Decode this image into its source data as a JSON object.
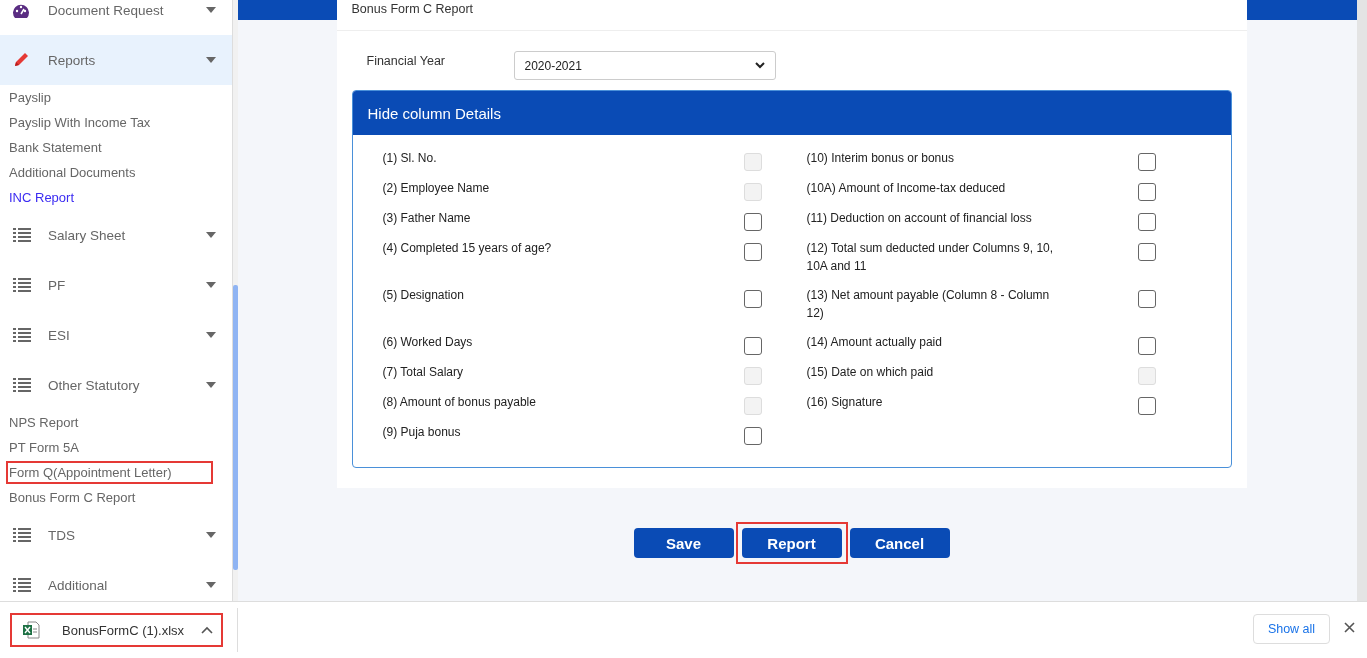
{
  "sidebar": {
    "entries": [
      {
        "kind": "group",
        "label": "Document Request",
        "selected": false
      },
      {
        "kind": "group",
        "label": "Reports",
        "selected": true
      },
      {
        "kind": "link",
        "label": "Payslip",
        "selected": false,
        "highlighted": false
      },
      {
        "kind": "link",
        "label": "Payslip With Income Tax",
        "selected": false,
        "highlighted": false
      },
      {
        "kind": "link",
        "label": "Bank Statement",
        "selected": false,
        "highlighted": false
      },
      {
        "kind": "link",
        "label": "Additional Documents",
        "selected": false,
        "highlighted": false
      },
      {
        "kind": "link",
        "label": "INC Report",
        "selected": true,
        "highlighted": false
      },
      {
        "kind": "group",
        "label": "Salary Sheet",
        "selected": false
      },
      {
        "kind": "group",
        "label": "PF",
        "selected": false
      },
      {
        "kind": "group",
        "label": "ESI",
        "selected": false
      },
      {
        "kind": "group",
        "label": "Other Statutory",
        "selected": false
      },
      {
        "kind": "link",
        "label": "NPS Report",
        "selected": false,
        "highlighted": false
      },
      {
        "kind": "link",
        "label": "PT Form 5A",
        "selected": false,
        "highlighted": false
      },
      {
        "kind": "link",
        "label": "Form Q(Appointment Letter)",
        "selected": false,
        "highlighted": true
      },
      {
        "kind": "link",
        "label": "Bonus Form C Report",
        "selected": false,
        "highlighted": false
      },
      {
        "kind": "group",
        "label": "TDS",
        "selected": false
      },
      {
        "kind": "group",
        "label": "Additional",
        "selected": false
      }
    ]
  },
  "card": {
    "title": "Bonus Form C Report",
    "financial_year": {
      "label": "Financial Year",
      "value": "2020-2021"
    },
    "panel": {
      "title": "Hide column Details",
      "rows": [
        {
          "left": {
            "label": "(1) Sl. No.",
            "disabled": true,
            "checked": false
          },
          "right": {
            "label": "(10) Interim bonus or bonus",
            "disabled": false,
            "checked": false
          }
        },
        {
          "left": {
            "label": "(2) Employee Name",
            "disabled": true,
            "checked": false
          },
          "right": {
            "label": "(10A) Amount of Income-tax deduced",
            "disabled": false,
            "checked": false
          }
        },
        {
          "left": {
            "label": "(3) Father Name",
            "disabled": false,
            "checked": false
          },
          "right": {
            "label": "(11) Deduction on account of financial loss",
            "disabled": false,
            "checked": false
          }
        },
        {
          "left": {
            "label": "(4) Completed 15 years of age?",
            "disabled": false,
            "checked": false
          },
          "right": {
            "label": "(12) Total sum deducted under Columns 9, 10, 10A and 11",
            "disabled": false,
            "checked": false
          }
        },
        {
          "left": {
            "label": "(5) Designation",
            "disabled": false,
            "checked": false
          },
          "right": {
            "label": "(13) Net amount payable (Column 8 - Column 12)",
            "disabled": false,
            "checked": false
          }
        },
        {
          "left": {
            "label": "(6) Worked Days",
            "disabled": false,
            "checked": false
          },
          "right": {
            "label": "(14) Amount actually paid",
            "disabled": false,
            "checked": false
          }
        },
        {
          "left": {
            "label": "(7) Total Salary",
            "disabled": true,
            "checked": false
          },
          "right": {
            "label": "(15) Date on which paid",
            "disabled": true,
            "checked": false
          }
        },
        {
          "left": {
            "label": "(8) Amount of bonus payable",
            "disabled": true,
            "checked": false
          },
          "right": {
            "label": "(16) Signature",
            "disabled": false,
            "checked": false
          }
        },
        {
          "left": {
            "label": "(9) Puja bonus",
            "disabled": false,
            "checked": false
          }
        }
      ]
    }
  },
  "buttons": [
    {
      "label": "Save",
      "highlighted": false
    },
    {
      "label": "Report",
      "highlighted": true
    },
    {
      "label": "Cancel",
      "highlighted": false
    }
  ],
  "download_bar": {
    "file": {
      "name": "BonusFormC (1).xlsx",
      "highlighted": true
    },
    "show_all": "Show all"
  }
}
